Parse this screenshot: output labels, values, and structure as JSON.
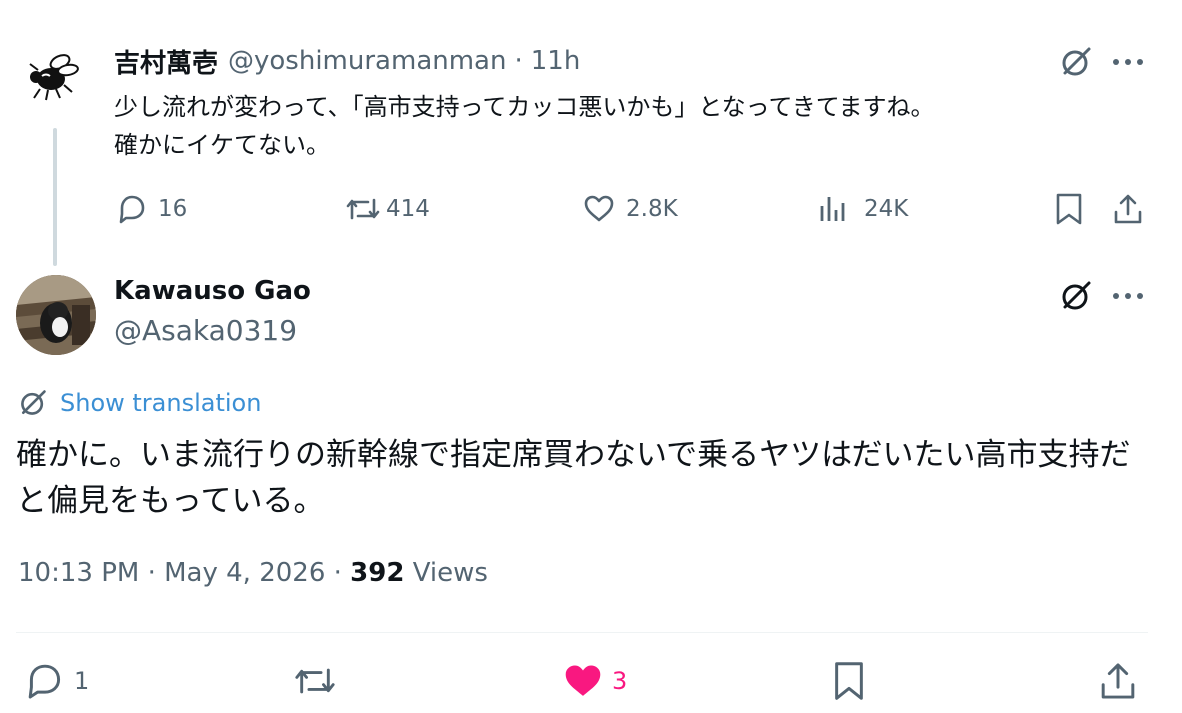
{
  "parent_tweet": {
    "display_name": "吉村萬壱",
    "handle": "@yoshimuramanman",
    "separator": "·",
    "time_ago": "11h",
    "text_lines": [
      "少し流れが変わって、「高市支持ってカッコ悪いかも」となってきてますね。",
      "確かにイケてない。"
    ],
    "actions": {
      "replies": "16",
      "reposts": "414",
      "likes": "2.8K",
      "views": "24K"
    }
  },
  "reply_tweet": {
    "display_name": "Kawauso Gao",
    "handle": "@Asaka0319",
    "show_translation_label": "Show translation",
    "text_lines": [
      "確かに。いま流行りの新幹線で指定席買わないで乗るヤツはだいたい高市支持だ",
      "と偏見をもっている。"
    ],
    "meta": {
      "time": "10:13 PM",
      "dot1": "·",
      "date": "May 4, 2026",
      "dot2": "·",
      "views_count": "392",
      "views_label": "Views"
    },
    "actions": {
      "replies": "1",
      "likes": "3"
    }
  },
  "colors": {
    "text_primary": "#0f1419",
    "text_secondary": "#536471",
    "link": "#3b8fd4",
    "like_active": "#f91880",
    "thread_line": "#cfd9de"
  },
  "icons": {
    "grok": "grok-slash-circle-icon",
    "more": "more-dots-icon",
    "reply": "reply-bubble-icon",
    "repost": "repost-arrows-icon",
    "like": "heart-icon",
    "views": "analytics-bars-icon",
    "bookmark": "bookmark-icon",
    "share": "share-upload-icon",
    "translate": "translate-grok-icon"
  }
}
